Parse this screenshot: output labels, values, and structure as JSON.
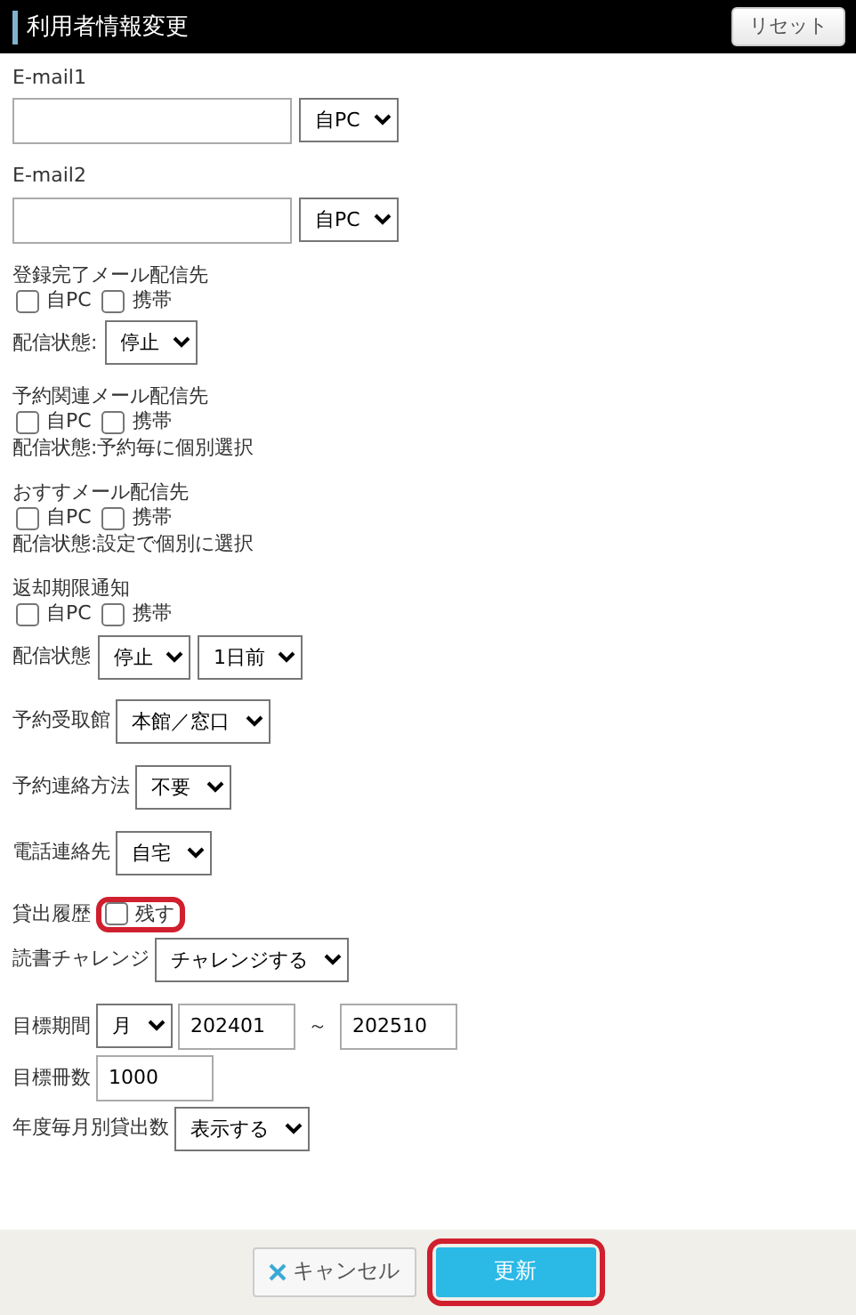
{
  "header": {
    "title": "利用者情報変更",
    "reset_button": "リセット"
  },
  "fields": [
    {
      "kind": "email",
      "label": "E-mail1",
      "select": "自PC"
    },
    {
      "kind": "email",
      "label": "E-mail2",
      "select": "自PC"
    },
    {
      "kind": "delivery",
      "label": "登録完了メール配信先",
      "options": [
        {
          "label": "自PC",
          "checked": false
        },
        {
          "label": "携帯",
          "checked": false
        }
      ],
      "status_label": "配信状態:",
      "status_selects": [
        "停止"
      ]
    },
    {
      "kind": "delivery",
      "label": "予約関連メール配信先",
      "options": [
        {
          "label": "自PC",
          "checked": false
        },
        {
          "label": "携帯",
          "checked": false
        }
      ],
      "status_text": "配信状態:予約毎に個別選択"
    },
    {
      "kind": "delivery",
      "label": "おすすメール配信先",
      "options": [
        {
          "label": "自PC",
          "checked": false
        },
        {
          "label": "携帯",
          "checked": false
        }
      ],
      "status_text": "配信状態:設定で個別に選択"
    },
    {
      "kind": "delivery",
      "label": "返却期限通知",
      "options": [
        {
          "label": "自PC",
          "checked": false
        },
        {
          "label": "携帯",
          "checked": false
        }
      ],
      "status_label": "配信状態",
      "status_selects": [
        "停止",
        "1日前"
      ]
    },
    {
      "kind": "row",
      "label": "予約受取館",
      "controls": [
        {
          "kind": "select",
          "value": "本館／窓口"
        }
      ]
    },
    {
      "kind": "row",
      "label": "予約連絡方法",
      "controls": [
        {
          "kind": "select",
          "value": "不要"
        }
      ]
    },
    {
      "kind": "row",
      "label": "電話連絡先",
      "controls": [
        {
          "kind": "select",
          "value": "自宅"
        }
      ]
    },
    {
      "kind": "row",
      "label": "貸出履歴",
      "controls": [
        {
          "kind": "checkbox",
          "label": "残す",
          "checked": false,
          "highlighted": true
        }
      ]
    },
    {
      "kind": "row",
      "label": "読書チャレンジ",
      "controls": [
        {
          "kind": "select",
          "value": "チャレンジする"
        }
      ]
    },
    {
      "kind": "row",
      "label": "目標期間",
      "controls": [
        {
          "kind": "select",
          "value": "月"
        },
        {
          "kind": "input",
          "value": "202401"
        },
        {
          "kind": "text",
          "value": "～"
        },
        {
          "kind": "input",
          "value": "202510"
        }
      ]
    },
    {
      "kind": "row",
      "label": "目標冊数",
      "controls": [
        {
          "kind": "input",
          "value": "1000"
        }
      ]
    },
    {
      "kind": "row",
      "label": "年度毎月別貸出数",
      "controls": [
        {
          "kind": "select",
          "value": "表示する"
        }
      ]
    }
  ],
  "footer": {
    "cancel_button": "キャンセル",
    "update_button": {
      "label": "更新",
      "highlighted": true
    }
  }
}
